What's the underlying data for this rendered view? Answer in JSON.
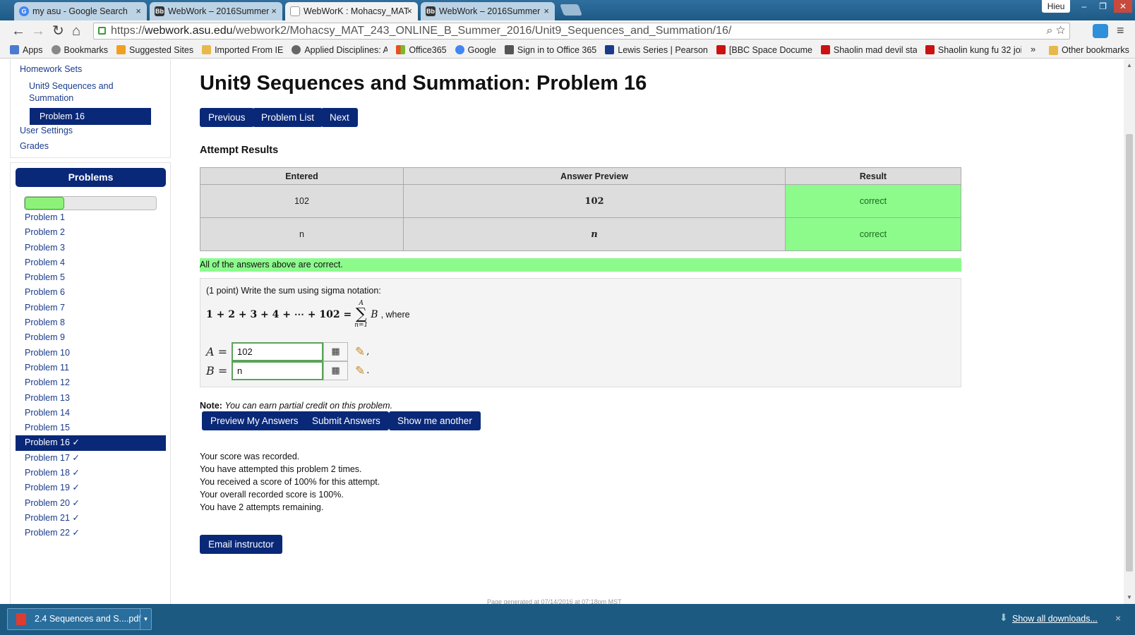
{
  "browser": {
    "tabs": [
      {
        "title": "my asu - Google Search",
        "icon": "google-icon"
      },
      {
        "title": "WebWork – 2016Summer",
        "icon": "blackboard-icon"
      },
      {
        "title": "WebWorK : Mohacsy_MAT",
        "icon": "document-icon",
        "active": true
      },
      {
        "title": "WebWork – 2016Summer",
        "icon": "blackboard-icon"
      }
    ],
    "tab_close": "×",
    "user": "Hieu",
    "window_buttons": {
      "minimize": "–",
      "restore": "❐",
      "close": "✕"
    },
    "url_host": "webwork.asu.edu",
    "url_scheme": "https://",
    "url_path": "/webwork2/Mohacsy_MAT_243_ONLINE_B_Summer_2016/Unit9_Sequences_and_Summation/16/",
    "bookmarks": [
      {
        "label": "Apps",
        "color": "#4a7bd0"
      },
      {
        "label": "Bookmarks",
        "color": "#888888"
      },
      {
        "label": "Suggested Sites",
        "color": "#f0a020"
      },
      {
        "label": "Imported From IE",
        "color": "#e8b84a"
      },
      {
        "label": "Applied Disciplines: A",
        "color": "#666666"
      },
      {
        "label": "Office365",
        "color": "#e85020"
      },
      {
        "label": "Google",
        "color": "#4285f4"
      },
      {
        "label": "Sign in to Office 365",
        "color": "#555555"
      },
      {
        "label": "Lewis Series | Pearson",
        "color": "#1b3a8c"
      },
      {
        "label": "[BBC Space Documen",
        "color": "#cc1111"
      },
      {
        "label": "Shaolin mad devil sta",
        "color": "#cc1111"
      },
      {
        "label": "Shaolin kung fu 32 joi",
        "color": "#cc1111"
      }
    ],
    "bookmarks_more": "»",
    "other_bookmarks": "Other bookmarks"
  },
  "sidebar": {
    "homework_sets": "Homework Sets",
    "set_name": "Unit9 Sequences and Summation",
    "current_problem": "Problem 16",
    "user_settings": "User Settings",
    "grades": "Grades",
    "problems_header": "Problems",
    "progress_fraction": 0.3,
    "problems": [
      "Problem 1",
      "Problem 2",
      "Problem 3",
      "Problem 4",
      "Problem 5",
      "Problem 6",
      "Problem 7",
      "Problem 8",
      "Problem 9",
      "Problem 10",
      "Problem 11",
      "Problem 12",
      "Problem 13",
      "Problem 14",
      "Problem 15",
      "Problem 16 ✓",
      "Problem 17 ✓",
      "Problem 18 ✓",
      "Problem 19 ✓",
      "Problem 20 ✓",
      "Problem 21 ✓",
      "Problem 22 ✓"
    ],
    "current_index": 15
  },
  "main": {
    "title": "Unit9 Sequences and Summation: Problem 16",
    "nav": {
      "previous": "Previous",
      "problem_list": "Problem List",
      "next": "Next"
    },
    "attempt_results_heading": "Attempt Results",
    "results_table": {
      "headers": [
        "Entered",
        "Answer Preview",
        "Result"
      ],
      "rows": [
        {
          "entered": "102",
          "preview": "102",
          "result": "correct"
        },
        {
          "entered": "n",
          "preview": "n",
          "result": "correct"
        }
      ]
    },
    "all_correct": "All of the answers above are correct.",
    "problem_text": "(1 point) Write the sum using sigma notation:",
    "equation_lhs": "1 + 2 + 3 + 4 + ⋯ + 102 =",
    "sigma_upper": "A",
    "sigma_lower": "n=1",
    "sigma_body": "B",
    "where": ", where",
    "answers": [
      {
        "var": "A =",
        "value": "102",
        "punct": ","
      },
      {
        "var": "B =",
        "value": "n",
        "punct": "."
      }
    ],
    "note_label": "Note:",
    "note_text": "You can earn partial credit on this problem.",
    "buttons": {
      "preview": "Preview My Answers",
      "submit": "Submit Answers",
      "another": "Show me another"
    },
    "status_lines": [
      "Your score was recorded.",
      "You have attempted this problem 2 times.",
      "You received a score of 100% for this attempt.",
      "Your overall recorded score is 100%.",
      "You have 2 attempts remaining."
    ],
    "email_instructor": "Email instructor",
    "footer": "Page generated at 07/14/2016 at 07:18pm MST"
  },
  "downloads": {
    "file": "2.4 Sequences and S....pdf",
    "show_all": "Show all downloads...",
    "close": "×"
  },
  "colors": {
    "accent": "#0a2878",
    "correct": "#8cfb8c"
  }
}
